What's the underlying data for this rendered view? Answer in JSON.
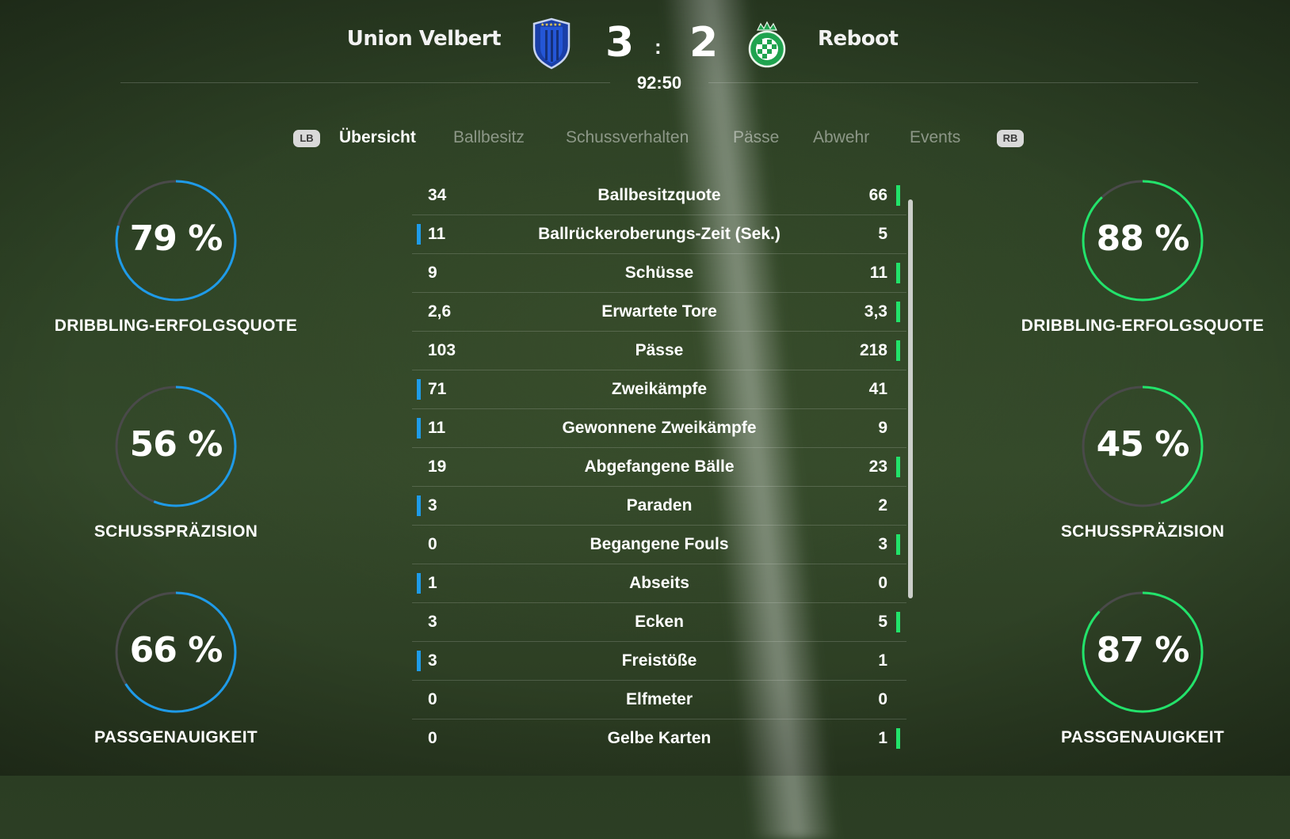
{
  "colors": {
    "home": "#1e9be8",
    "away": "#22e36a",
    "track": "#4a4a4a"
  },
  "match": {
    "home_team": "Union Velbert",
    "away_team": "Reboot",
    "home_score": "3",
    "separator": ":",
    "away_score": "2",
    "clock": "92:50",
    "home_crest_icon": "blue-shield-crest",
    "away_crest_icon": "green-checkered-crown-crest"
  },
  "tabs": {
    "left_bumper": "LB",
    "right_bumper": "RB",
    "items": [
      "Übersicht",
      "Ballbesitz",
      "Schussverhalten",
      "Pässe",
      "Abwehr",
      "Events"
    ],
    "active": "Übersicht"
  },
  "rings": {
    "home": [
      {
        "value_text": "79 %",
        "fraction": 0.79,
        "label": "DRIBBLING-ERFOLGSQUOTE"
      },
      {
        "value_text": "56 %",
        "fraction": 0.56,
        "label": "SCHUSSPRÄZISION"
      },
      {
        "value_text": "66 %",
        "fraction": 0.66,
        "label": "PASSGENAUIGKEIT"
      }
    ],
    "away": [
      {
        "value_text": "88 %",
        "fraction": 0.88,
        "label": "DRIBBLING-ERFOLGSQUOTE"
      },
      {
        "value_text": "45 %",
        "fraction": 0.45,
        "label": "SCHUSSPRÄZISION"
      },
      {
        "value_text": "87 %",
        "fraction": 0.87,
        "label": "PASSGENAUIGKEIT"
      }
    ]
  },
  "stats": [
    {
      "home": "34",
      "name": "Ballbesitzquote",
      "away": "66",
      "leader": "away"
    },
    {
      "home": "11",
      "name": "Ballrückeroberungs-Zeit (Sek.)",
      "away": "5",
      "leader": "home"
    },
    {
      "home": "9",
      "name": "Schüsse",
      "away": "11",
      "leader": "away"
    },
    {
      "home": "2,6",
      "name": "Erwartete Tore",
      "away": "3,3",
      "leader": "away"
    },
    {
      "home": "103",
      "name": "Pässe",
      "away": "218",
      "leader": "away"
    },
    {
      "home": "71",
      "name": "Zweikämpfe",
      "away": "41",
      "leader": "home"
    },
    {
      "home": "11",
      "name": "Gewonnene Zweikämpfe",
      "away": "9",
      "leader": "home"
    },
    {
      "home": "19",
      "name": "Abgefangene Bälle",
      "away": "23",
      "leader": "away"
    },
    {
      "home": "3",
      "name": "Paraden",
      "away": "2",
      "leader": "home"
    },
    {
      "home": "0",
      "name": "Begangene Fouls",
      "away": "3",
      "leader": "away"
    },
    {
      "home": "1",
      "name": "Abseits",
      "away": "0",
      "leader": "home"
    },
    {
      "home": "3",
      "name": "Ecken",
      "away": "5",
      "leader": "away"
    },
    {
      "home": "3",
      "name": "Freistöße",
      "away": "1",
      "leader": "home"
    },
    {
      "home": "0",
      "name": "Elfmeter",
      "away": "0",
      "leader": "none"
    },
    {
      "home": "0",
      "name": "Gelbe Karten",
      "away": "1",
      "leader": "away"
    }
  ]
}
